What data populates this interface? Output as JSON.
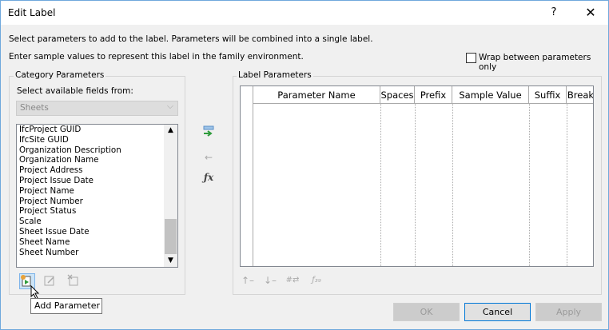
{
  "window": {
    "title": "Edit Label",
    "help_label": "?",
    "close_label": "✕"
  },
  "description": {
    "line1": "Select parameters to add to the label.  Parameters will be combined into a single label.",
    "line2": "Enter sample values to represent this label in the family environment."
  },
  "wrap_checkbox": {
    "label": "Wrap between parameters only",
    "checked": false
  },
  "category": {
    "group_title": "Category Parameters",
    "fields_label": "Select available fields from:",
    "selected_source": "Sheets",
    "items": [
      "IfcProject GUID",
      "IfcSite GUID",
      "Organization Description",
      "Organization Name",
      "Project Address",
      "Project Issue Date",
      "Project Name",
      "Project Number",
      "Project Status",
      "Scale",
      "Sheet Issue Date",
      "Sheet Name",
      "Sheet Number"
    ]
  },
  "label_params": {
    "group_title": "Label Parameters",
    "columns": [
      "Parameter Name",
      "Spaces",
      "Prefix",
      "Sample Value",
      "Suffix",
      "Break"
    ]
  },
  "icons": {
    "add_to_label": "add-to-label-icon",
    "remove_from_label": "remove-from-label-icon",
    "calculated_value": "fx-icon",
    "add_parameter": "add-parameter-icon",
    "edit_parameter": "edit-parameter-icon",
    "delete_parameter": "delete-parameter-icon",
    "move_up": "move-up-icon",
    "move_down": "move-down-icon",
    "sort": "sort-icon",
    "format": "format-icon"
  },
  "tooltip": "Add Parameter",
  "buttons": {
    "ok": "OK",
    "cancel": "Cancel",
    "apply": "Apply"
  },
  "colors": {
    "accent": "#0078d7",
    "green_arrow": "#2e9b3b"
  }
}
